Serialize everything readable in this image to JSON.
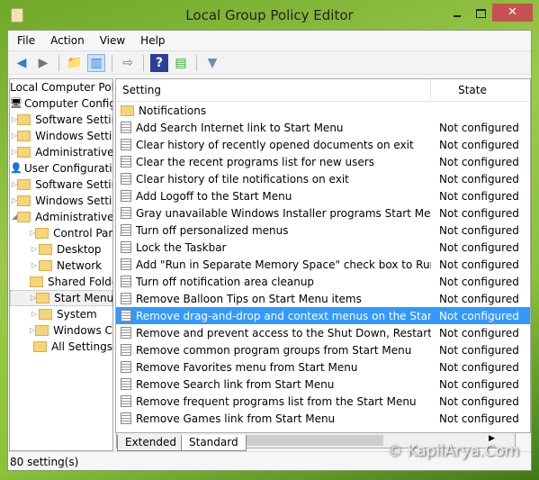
{
  "window": {
    "title": "Local Group Policy Editor",
    "close": "✕"
  },
  "menu": [
    "File",
    "Action",
    "View",
    "Help"
  ],
  "toolbar": [
    "back-icon",
    "forward-icon",
    "up-folder-icon",
    "show-hide-tree-icon",
    "export-list-icon",
    "help-icon",
    "show-hide-action-pane-icon",
    "filter-icon"
  ],
  "tree": [
    {
      "label": "Local Computer Policy",
      "level": 0
    },
    {
      "label": "Computer Configuration",
      "level": 0,
      "icon": "computer"
    },
    {
      "label": "Software Settings",
      "level": 1
    },
    {
      "label": "Windows Settings",
      "level": 1
    },
    {
      "label": "Administrative Templates",
      "level": 1
    },
    {
      "label": "User Configuration",
      "level": 0,
      "icon": "user"
    },
    {
      "label": "Software Settings",
      "level": 1
    },
    {
      "label": "Windows Settings",
      "level": 1
    },
    {
      "label": "Administrative Templates",
      "level": 1,
      "expanded": true
    },
    {
      "label": "Control Panel",
      "level": 2
    },
    {
      "label": "Desktop",
      "level": 2
    },
    {
      "label": "Network",
      "level": 2
    },
    {
      "label": "Shared Folders",
      "level": 2
    },
    {
      "label": "Start Menu and Taskbar",
      "level": 2,
      "selected": true
    },
    {
      "label": "System",
      "level": 2
    },
    {
      "label": "Windows Components",
      "level": 2
    },
    {
      "label": "All Settings",
      "level": 2
    }
  ],
  "list": {
    "headers": [
      "Setting",
      "State"
    ],
    "rows": [
      {
        "setting": "Notifications",
        "state": "",
        "folder": true
      },
      {
        "setting": "Add Search Internet link to Start Menu",
        "state": "Not configured"
      },
      {
        "setting": "Clear history of recently opened documents on exit",
        "state": "Not configured"
      },
      {
        "setting": "Clear the recent programs list for new users",
        "state": "Not configured"
      },
      {
        "setting": "Clear history of tile notifications on exit",
        "state": "Not configured"
      },
      {
        "setting": "Add Logoff to the Start Menu",
        "state": "Not configured"
      },
      {
        "setting": "Gray unavailable Windows Installer programs Start Menu shortcuts",
        "state": "Not configured"
      },
      {
        "setting": "Turn off personalized menus",
        "state": "Not configured"
      },
      {
        "setting": "Lock the Taskbar",
        "state": "Not configured"
      },
      {
        "setting": "Add \"Run in Separate Memory Space\" check box to Run dialog box",
        "state": "Not configured"
      },
      {
        "setting": "Turn off notification area cleanup",
        "state": "Not configured"
      },
      {
        "setting": "Remove Balloon Tips on Start Menu items",
        "state": "Not configured"
      },
      {
        "setting": "Remove drag-and-drop and context menus on the Start Menu",
        "state": "Not configured",
        "selected": true
      },
      {
        "setting": "Remove and prevent access to the Shut Down, Restart, Sleep, and Hibernate commands",
        "state": "Not configured"
      },
      {
        "setting": "Remove common program groups from Start Menu",
        "state": "Not configured"
      },
      {
        "setting": "Remove Favorites menu from Start Menu",
        "state": "Not configured"
      },
      {
        "setting": "Remove Search link from Start Menu",
        "state": "Not configured"
      },
      {
        "setting": "Remove frequent programs list from the Start Menu",
        "state": "Not configured"
      },
      {
        "setting": "Remove Games link from Start Menu",
        "state": "Not configured"
      }
    ]
  },
  "tabs": [
    "Extended",
    "Standard"
  ],
  "status": "80 setting(s)",
  "watermark": "© KapilArya.Com",
  "colors": {
    "selection": "#3399ff",
    "close": "#c75050"
  }
}
